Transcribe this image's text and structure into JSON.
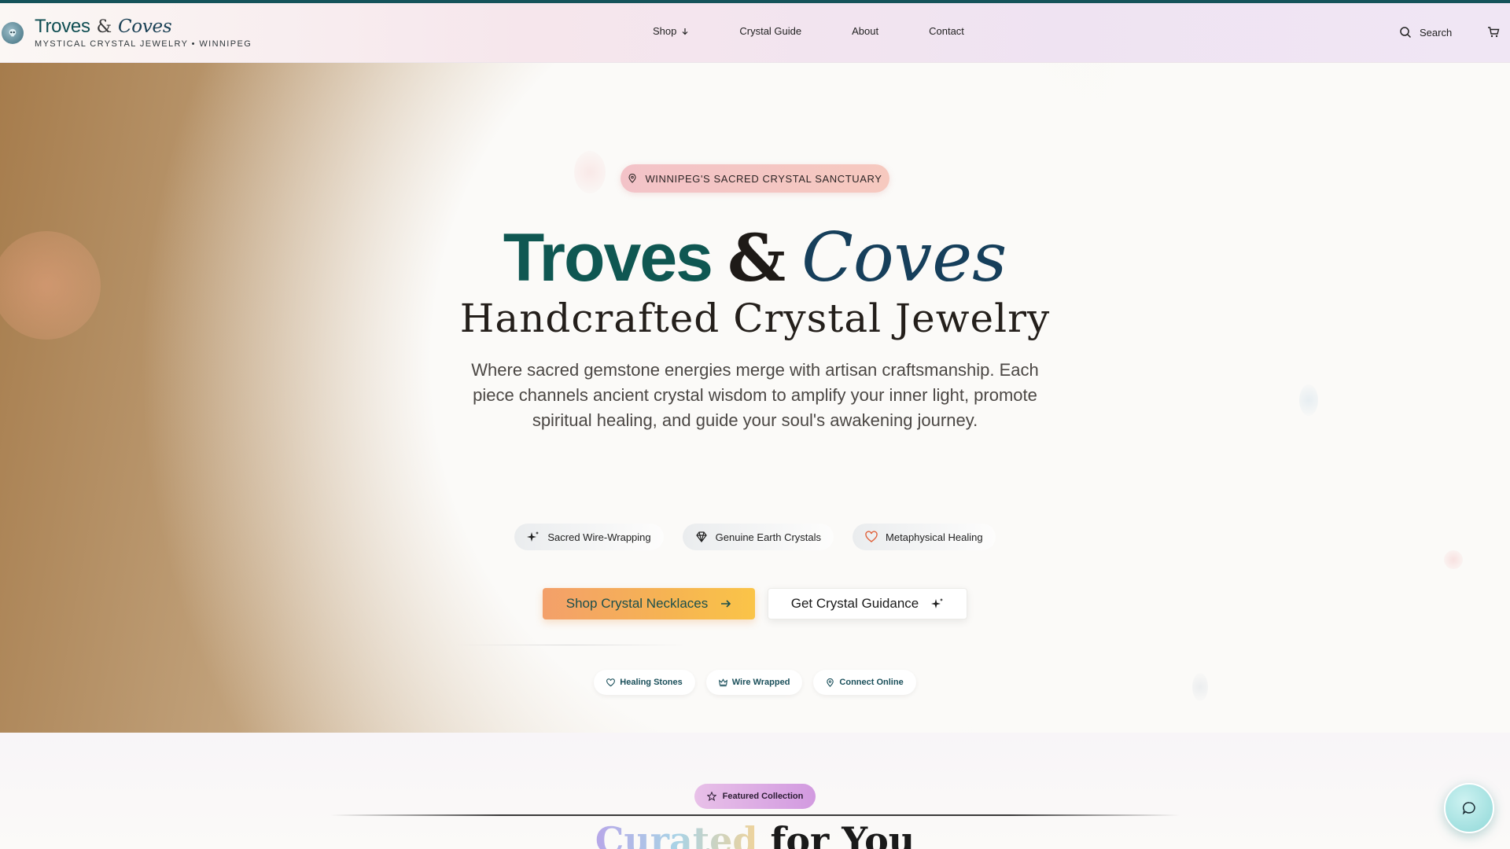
{
  "header": {
    "brand_title": "Troves",
    "brand_amp": "&",
    "brand_script": "Coves",
    "brand_subtitle": "MYSTICAL CRYSTAL JEWELRY • WINNIPEG",
    "nav": [
      {
        "label": "Shop",
        "icon": "arrow-down-icon"
      },
      {
        "label": "Crystal Guide"
      },
      {
        "label": "About"
      },
      {
        "label": "Contact"
      }
    ],
    "search_label": "Search",
    "icons": {
      "search": "search-icon",
      "cart": "cart-icon",
      "logo": "skull-crystal-icon"
    }
  },
  "hero": {
    "location_pill": "WINNIPEG'S SACRED CRYSTAL SANCTUARY",
    "title_main": "Troves",
    "title_amp": "&",
    "title_script": "Coves",
    "subtitle": "Handcrafted Crystal Jewelry",
    "description": "Where sacred gemstone energies merge with artisan craftsmanship. Each piece channels ancient crystal wisdom to amplify your inner light, promote spiritual healing, and guide your soul's awakening journey.",
    "features": [
      {
        "label": "Sacred Wire-Wrapping",
        "icon": "sparkles-icon"
      },
      {
        "label": "Genuine Earth Crystals",
        "icon": "gem-icon"
      },
      {
        "label": "Metaphysical Healing",
        "icon": "heart-icon"
      }
    ],
    "cta_primary": "Shop Crystal Necklaces",
    "cta_secondary": "Get Crystal Guidance",
    "chips": [
      {
        "label": "Healing Stones",
        "icon": "heart-icon"
      },
      {
        "label": "Wire Wrapped",
        "icon": "crown-icon"
      },
      {
        "label": "Connect Online",
        "icon": "map-pin-icon"
      }
    ]
  },
  "featured": {
    "pill": "Featured Collection",
    "title_grad": "Curated",
    "title_rest": "for You"
  },
  "colors": {
    "brand_teal": "#0f5752",
    "brand_navy": "#163f5b",
    "cta_orange": "#f3a06a",
    "cta_yellow": "#fac448",
    "pill_pink": "#f3c3c8",
    "featured_purple": "#d29ae0"
  }
}
